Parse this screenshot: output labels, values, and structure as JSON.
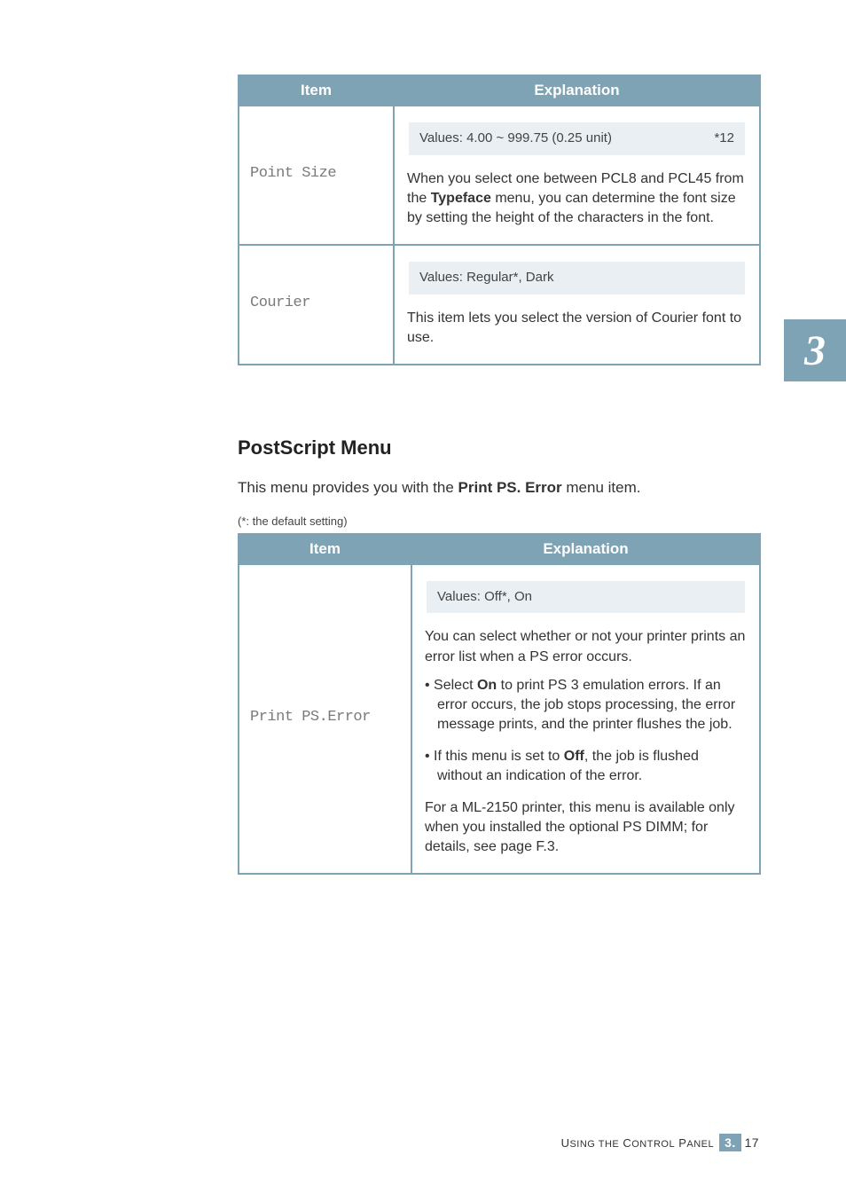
{
  "side_tab": "3",
  "table1": {
    "headers": {
      "item": "Item",
      "explanation": "Explanation"
    },
    "rows": [
      {
        "item": "Point Size",
        "values_left": "Values: 4.00 ~ 999.75 (0.25 unit)",
        "values_right": "*12",
        "body_prefix": "When you select one between PCL8 and PCL45 from the ",
        "body_bold": "Typeface",
        "body_suffix": " menu, you can determine the font size by setting the height of the characters in the font."
      },
      {
        "item": "Courier",
        "values_left": "Values: Regular*, Dark",
        "body": "This item lets you select the version of Courier font to use."
      }
    ]
  },
  "section_title": "PostScript Menu",
  "intro_prefix": "This menu provides you with the ",
  "intro_bold": "Print PS. Error",
  "intro_suffix": " menu item.",
  "default_note": "(*: the default setting)",
  "table2": {
    "headers": {
      "item": "Item",
      "explanation": "Explanation"
    },
    "row": {
      "item": "Print PS.Error",
      "values": "Values: Off*, On",
      "p1": "You can select whether or not your printer prints an error list when a PS error occurs.",
      "b1_prefix": "Select ",
      "b1_bold": "On",
      "b1_suffix": " to print PS 3 emulation errors. If an error occurs, the job stops processing, the error message prints, and the printer flushes the job.",
      "b2_prefix": "If this menu is set to ",
      "b2_bold": "Off",
      "b2_suffix": ", the job is flushed without an indication of the error.",
      "p2": "For a ML-2150 printer, this menu is available only when you installed the optional PS DIMM; for details, see page F.3."
    }
  },
  "footer": {
    "label_a": "Using the",
    "label_b": " Control Panel",
    "page_major": "3.",
    "page_minor": "17"
  }
}
